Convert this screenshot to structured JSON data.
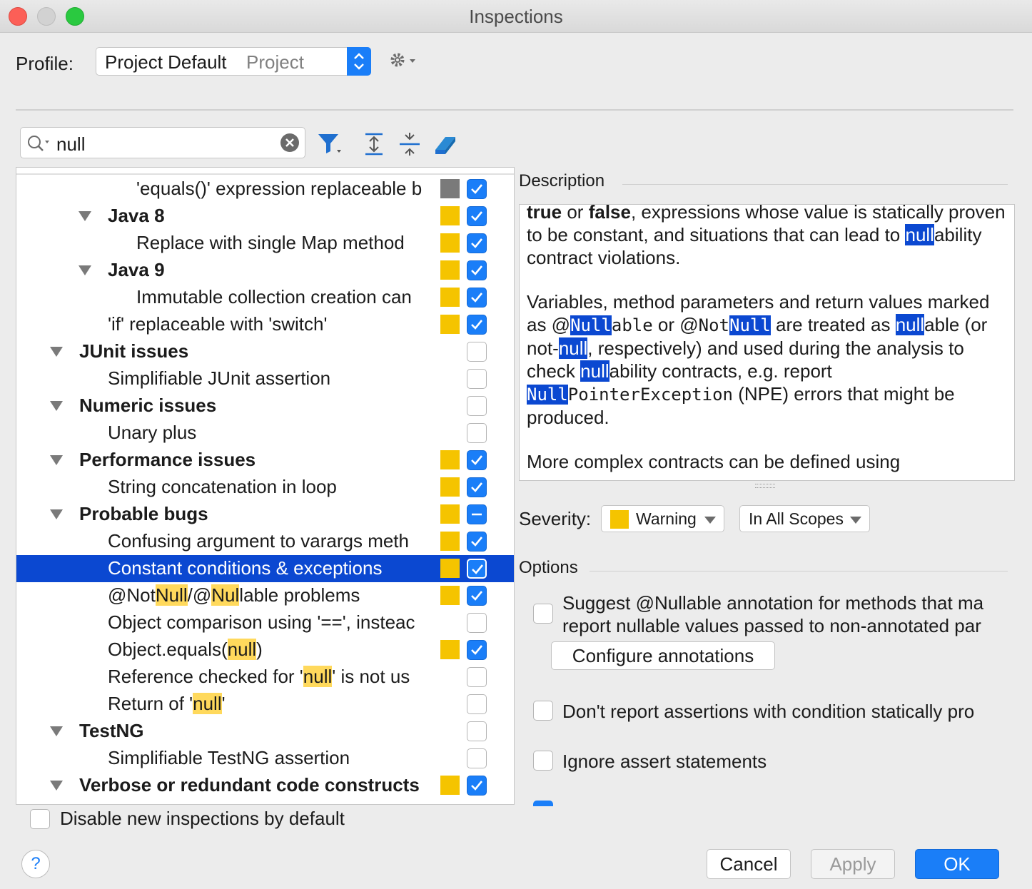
{
  "window": {
    "title": "Inspections"
  },
  "profile": {
    "label": "Profile:",
    "name": "Project Default",
    "scope": "Project"
  },
  "search": {
    "value": "null"
  },
  "tree": {
    "rows": [
      {
        "label": "'equals()' expression replaceable b",
        "level": 3,
        "severity": "gray",
        "checkbox": "on"
      },
      {
        "label": "Java 8",
        "level": 2,
        "group": true,
        "severity": "warning",
        "checkbox": "on"
      },
      {
        "label": "Replace with single Map method",
        "level": 3,
        "severity": "warning",
        "checkbox": "on"
      },
      {
        "label": "Java 9",
        "level": 2,
        "group": true,
        "severity": "warning",
        "checkbox": "on"
      },
      {
        "label": "Immutable collection creation can",
        "level": 3,
        "severity": "warning",
        "checkbox": "on"
      },
      {
        "label": "'if' replaceable with 'switch'",
        "level": 2,
        "severity": "warning",
        "checkbox": "on"
      },
      {
        "label": "JUnit issues",
        "level": 1,
        "group": true,
        "severity": "",
        "checkbox": "off"
      },
      {
        "label": "Simplifiable JUnit assertion",
        "level": 2,
        "severity": "",
        "checkbox": "off"
      },
      {
        "label": "Numeric issues",
        "level": 1,
        "group": true,
        "severity": "",
        "checkbox": "off"
      },
      {
        "label": "Unary plus",
        "level": 2,
        "severity": "",
        "checkbox": "off"
      },
      {
        "label": "Performance issues",
        "level": 1,
        "group": true,
        "severity": "warning",
        "checkbox": "on"
      },
      {
        "label": "String concatenation in loop",
        "level": 2,
        "severity": "warning",
        "checkbox": "on"
      },
      {
        "label": "Probable bugs",
        "level": 1,
        "group": true,
        "severity": "warning",
        "checkbox": "mixed"
      },
      {
        "label": "Confusing argument to varargs meth",
        "level": 2,
        "severity": "warning",
        "checkbox": "on"
      },
      {
        "label": "Constant conditions & exceptions",
        "level": 2,
        "severity": "warning",
        "checkbox": "on",
        "selected": true
      },
      {
        "parts": [
          "@Not",
          "Null",
          "/@",
          "Nul",
          "lable problems"
        ],
        "level": 2,
        "severity": "warning",
        "checkbox": "on"
      },
      {
        "label": "Object comparison using '==', insteac",
        "level": 2,
        "severity": "",
        "checkbox": "off"
      },
      {
        "parts": [
          "Object.equals(",
          "null",
          ")"
        ],
        "level": 2,
        "severity": "warning",
        "checkbox": "on"
      },
      {
        "parts": [
          "Reference checked for '",
          "null",
          "' is not us"
        ],
        "level": 2,
        "severity": "",
        "checkbox": "off"
      },
      {
        "parts": [
          "Return of '",
          "null",
          "'"
        ],
        "level": 2,
        "severity": "",
        "checkbox": "off"
      },
      {
        "label": "TestNG",
        "level": 1,
        "group": true,
        "severity": "",
        "checkbox": "off"
      },
      {
        "label": "Simplifiable TestNG assertion",
        "level": 2,
        "severity": "",
        "checkbox": "off"
      },
      {
        "label": "Verbose or redundant code constructs",
        "level": 1,
        "group": true,
        "severity": "warning",
        "checkbox": "on"
      }
    ]
  },
  "disable_new": {
    "label": "Disable new inspections by default"
  },
  "description": {
    "title": "Description",
    "p1": {
      "b1": "true",
      "t1": " or ",
      "b2": "false",
      "t2": ", expressions whose value is statically proven to be constant, and situations that can lead to ",
      "m1": "null",
      "t3": "ability contract violations."
    },
    "p2": {
      "t1": "Variables, method parameters and return values marked as @",
      "m1": "Null",
      "c1": "able",
      "t2": " or @",
      "c2": "Not",
      "m2": "Null",
      "t3": " are treated as ",
      "m3": "null",
      "t4": "able (or not-",
      "m4": "null",
      "t5": ", respectively) and used during the analysis to check ",
      "m5": "null",
      "t6": "ability contracts, e.g. report ",
      "m6": "Null",
      "c3": "PointerException",
      "t7": " (NPE) errors that might be produced."
    },
    "p3": "More complex contracts can be defined using"
  },
  "severity": {
    "label": "Severity:",
    "level": "Warning",
    "scope": "In All Scopes",
    "color": "#f5c400"
  },
  "options": {
    "title": "Options",
    "suggest_line1": "Suggest @Nullable annotation for methods that ma",
    "suggest_line2": "report nullable values passed to non-annotated par",
    "configure_button": "Configure annotations",
    "dont_report": "Don't report assertions with condition statically pro",
    "ignore_assert": "Ignore assert statements"
  },
  "buttons": {
    "help": "?",
    "cancel": "Cancel",
    "apply": "Apply",
    "ok": "OK"
  },
  "colors": {
    "accent": "#1a7ef8",
    "selection": "#0b48d1",
    "warning": "#f5c400",
    "highlight": "#ffd95c"
  }
}
